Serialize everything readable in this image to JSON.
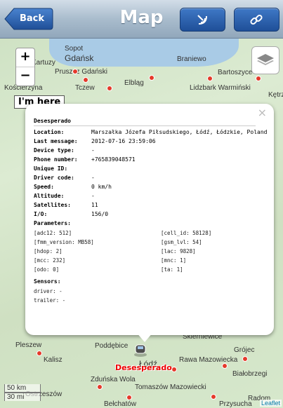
{
  "header": {
    "back_label": "Back",
    "title": "Map",
    "accent": "#2a5ba8"
  },
  "map": {
    "zoom_in": "+",
    "zoom_out": "−",
    "im_here": "I'm here",
    "places": [
      "Sopot",
      "Kartuzy",
      "Gdańsk",
      "Pruszcz Gdański",
      "Braniewo",
      "Bartoszyce",
      "Kościerzyna",
      "Tczew",
      "Elbląg",
      "Lidzbark Warmiński",
      "Kętrz",
      "Pleszew",
      "Poddębice",
      "Skierniewice",
      "Grójec",
      "Kalisz",
      "Łódź",
      "Rawa Mazowiecka",
      "Białobrzegi",
      "Zduńska Wola",
      "Tomaszów Mazowiecki",
      "Bełchatów",
      "Przysucha",
      "Radom",
      "Ostrzeszów"
    ],
    "marker_label": "Desesperado",
    "scale_km": "50 km",
    "scale_mi": "30 mi",
    "attribution": "Leaflet"
  },
  "popup": {
    "close": "×",
    "title": "Desesperado",
    "fields": [
      {
        "label": "Location:",
        "value": "Marszałka Józefa Piłsudskiego, Łódź, Łódzkie, Poland"
      },
      {
        "label": "Last message:",
        "value": "2012-07-16 23:59:06"
      },
      {
        "label": "Device type:",
        "value": "-"
      },
      {
        "label": "Phone number:",
        "value": "+765839048571"
      },
      {
        "label": "Unique ID:",
        "value": ""
      },
      {
        "label": "Driver code:",
        "value": "-"
      },
      {
        "label": "Speed:",
        "value": "0 km/h"
      },
      {
        "label": "Altitude:",
        "value": "-"
      },
      {
        "label": "Satellites:",
        "value": "11"
      },
      {
        "label": "I/O:",
        "value": "156/0"
      }
    ],
    "parameters_label": "Parameters:",
    "parameters_left": [
      "[adc12: 512]",
      "[fmm_version: MB58]",
      "[hdop: 2]",
      "[mcc: 232]",
      "[odo: 0]"
    ],
    "parameters_right": [
      "[cell_id: 58128]",
      "[gsm_lvl: 54]",
      "[lac: 9828]",
      "[mnc: 1]",
      "[ta: 1]"
    ],
    "sensors_label": "Sensors:",
    "sensors": [
      "driver: -",
      "trailer: -"
    ]
  }
}
